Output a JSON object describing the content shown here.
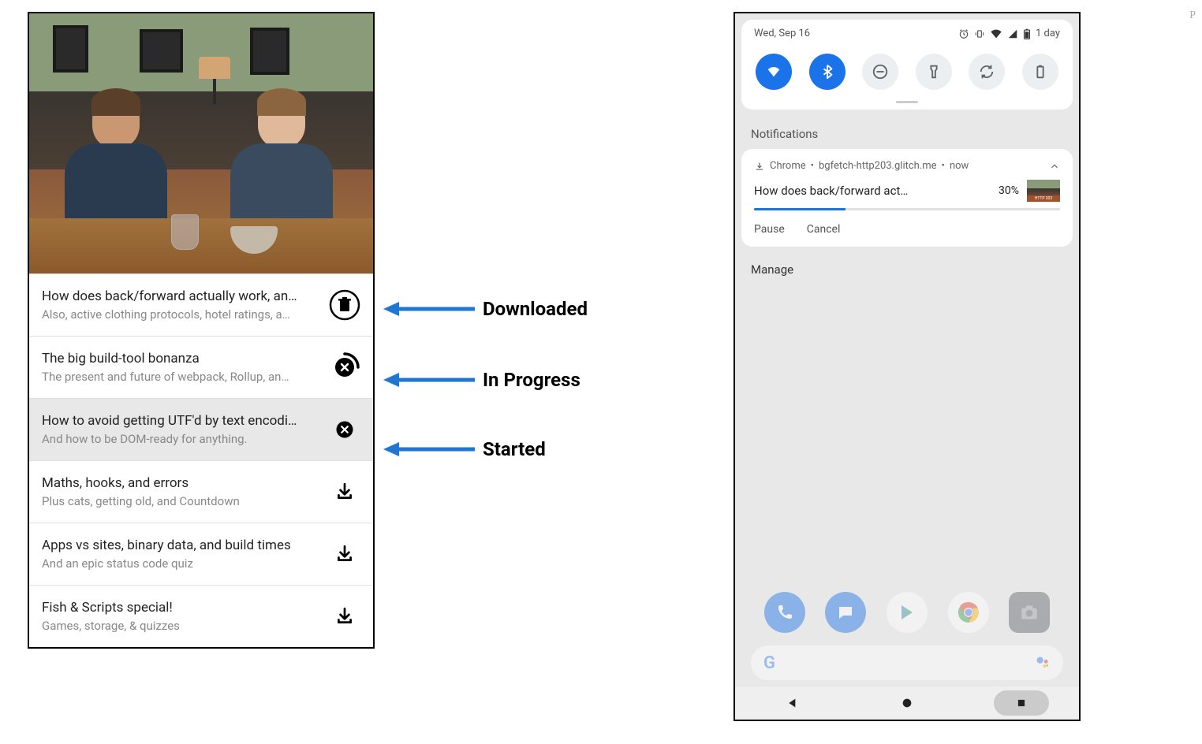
{
  "left": {
    "items": [
      {
        "title": "How does back/forward actually work, an…",
        "subtitle": "Also, active clothing protocols, hotel ratings, a…",
        "state": "downloaded"
      },
      {
        "title": "The big build-tool bonanza",
        "subtitle": "The present and future of webpack, Rollup, an…",
        "state": "in-progress"
      },
      {
        "title": "How to avoid getting UTF'd by text encodi…",
        "subtitle": "And how to be DOM-ready for anything.",
        "state": "started",
        "selected": true
      },
      {
        "title": "Maths, hooks, and errors",
        "subtitle": "Plus cats, getting old, and Countdown",
        "state": "not-downloaded"
      },
      {
        "title": "Apps vs sites, binary data, and build times",
        "subtitle": "And an epic status code quiz",
        "state": "not-downloaded"
      },
      {
        "title": "Fish & Scripts special!",
        "subtitle": "Games, storage, & quizzes",
        "state": "not-downloaded"
      }
    ]
  },
  "annotations": {
    "downloaded": "Downloaded",
    "in_progress": "In Progress",
    "started": "Started"
  },
  "right": {
    "status_date": "Wed, Sep 16",
    "battery_text": "1 day",
    "notifications_heading": "Notifications",
    "notif": {
      "app": "Chrome",
      "source": "bgfetch-http203.glitch.me",
      "time": "now",
      "title": "How does back/forward act…",
      "percent": "30%",
      "progress": 30,
      "actions": [
        "Pause",
        "Cancel"
      ]
    },
    "manage": "Manage"
  },
  "edge_char": "P"
}
